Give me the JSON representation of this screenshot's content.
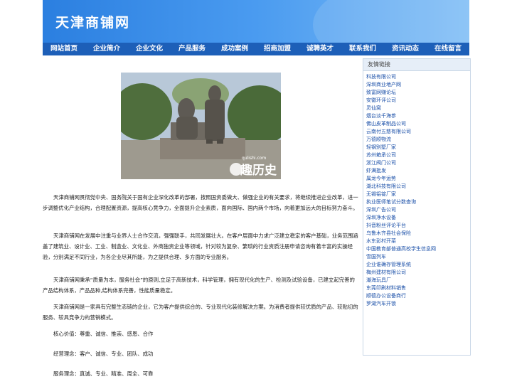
{
  "site": {
    "title": "天津商铺网"
  },
  "nav": [
    "网站首页",
    "企业简介",
    "企业文化",
    "产品服务",
    "成功案例",
    "招商加盟",
    "诚聘英才",
    "联系我们",
    "资讯动态",
    "在线留言"
  ],
  "hero": {
    "watermark_url": "qulishi.com",
    "watermark_logo": "趣历史"
  },
  "paragraphs": [
    "天津商铺网贯彻党中央、国务院关于国有企业深化改革的部署，按照国资委做大、做强企业的有关要求，将继续推进企业改革，进一步调整优化产业结构，合理配置资源，提高核心竞争力，全面提升企业素质，面向国际、国内两个市场，向着更加远大的目标努力奋斗。",
    "天津商铺网在发展中注重与业界人士合作交流，强强联手，共同发展壮大。在客户层面中力求广泛建立稳定的客户基础，业务范围涵盖了建筑业、设计业、工业、制造业、文化业、外商独资企业等领域，针对较为复杂、繁琐的行业资质注册申请咨询有着丰富的实操经验，分别满足不同行业，为各企业尽其所能，为之提供合理、多方面的专业服务。",
    "天津商铺网秉承“质量为本，服务社会”的原则,立足于高新技术，科学管理，拥有现代化的生产、检测及试验设备，已建立起完善的产品结构体系，产品品种,结构体系完善，性能质量稳定。",
    "天津商铺网是一家具有完整生态链的企业，它为客户提供综合的、专业现代化装修解决方案。为消费者提供较优质的产品、较贴切的服务、较具竞争力的营销模式。",
    "核心价值：尊重、诚信、推崇、感恩、合作",
    "经营理念：客户、诚信、专业、团队、成功",
    "服务理念：真诚、专业、精准、周全、可靠"
  ],
  "sidebar": {
    "title": "友情链接",
    "links": [
      "科技有限公司",
      "深圳商业地产网",
      "致富网赚论坛",
      "安徽环评公司",
      "灵仙窝",
      "烟台淡千海参",
      "佛山皮革制品公司",
      "云南付五慈有限公司",
      "万德顺物流",
      "轻钢别墅厂家",
      "苏州箱承公司",
      "浙江阀门公司",
      "虾满批发",
      "属龙今年运势",
      "湖北科技有限公司",
      "无锡铝锭厂家",
      "执业医师笔试分数查询",
      "深圳广告公司",
      "深圳净水设备",
      "抖音粉丝评论平台",
      "乌鲁木齐县社会保险",
      "水东彭村开菜",
      "中国教育部普通高校学生信息网",
      "雪国列车",
      "企业谁确存管理系统",
      "梅州建材有限公司",
      "潮海玩具厂",
      "东莞印刷材料销售",
      "顺德办公设备商行",
      "罗湖汽车开锁"
    ]
  }
}
